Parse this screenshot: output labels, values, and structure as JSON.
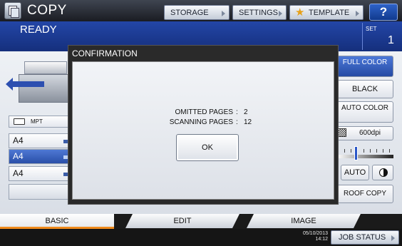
{
  "header": {
    "title": "COPY",
    "storage_label": "STORAGE",
    "settings_label": "SETTINGS",
    "template_label": "TEMPLATE",
    "help_label": "?"
  },
  "status": {
    "text": "READY",
    "set_label": "SET",
    "set_count": "1"
  },
  "trays": {
    "mpt_label": "MPT",
    "items": [
      "A4",
      "A4",
      "A4"
    ],
    "selected_index": 1
  },
  "color_mode": {
    "full_color": "FULL COLOR",
    "black": "BLACK",
    "auto_color": "AUTO COLOR"
  },
  "resolution": {
    "partial": "0dpi",
    "dpi_600": "600dpi"
  },
  "density": {
    "auto_label": "AUTO"
  },
  "proof_copy_label": "ROOF COPY",
  "dialog": {
    "title": "CONFIRMATION",
    "omitted_label": "OMITTED PAGES",
    "omitted_value": "2",
    "scanning_label": "SCANNING PAGES",
    "scanning_value": "12",
    "separator": ":",
    "ok_label": "OK"
  },
  "tabs": {
    "basic": "BASIC",
    "edit": "EDIT",
    "image": "IMAGE",
    "active": "BASIC"
  },
  "footer": {
    "date": "05/10/2013",
    "time": "14:12",
    "job_status_label": "JOB STATUS"
  },
  "colors": {
    "status_blue": "#2346a7",
    "selected_blue": "#2a4fa8",
    "active_tab_accent": "#ef8a1c",
    "template_star": "#e6a11a"
  },
  "icons": [
    "copy-app-icon",
    "star-icon",
    "copier-icon",
    "mpt-tray-icon",
    "dpi-pattern-icon",
    "half-circle-icon",
    "chevron-right-icon"
  ]
}
